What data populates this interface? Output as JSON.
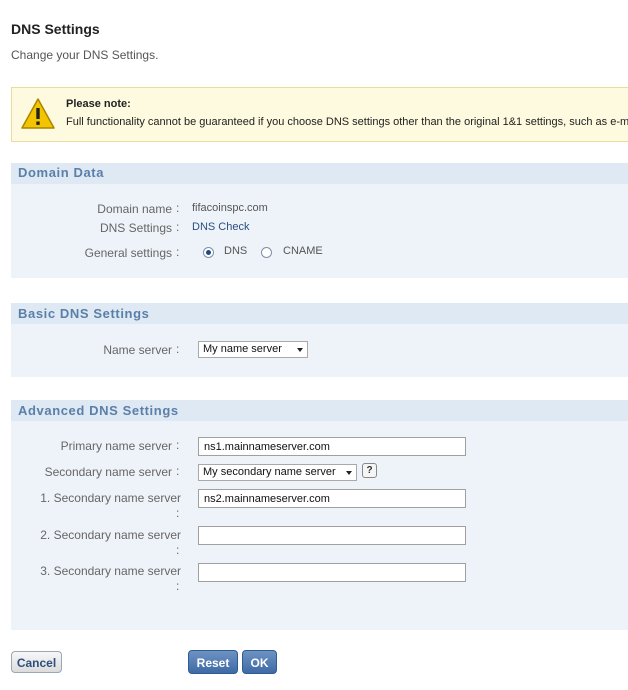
{
  "page": {
    "title": "DNS Settings",
    "subtitle": "Change your DNS Settings."
  },
  "note": {
    "icon": "warning-icon",
    "title": "Please note:",
    "text": "Full functionality cannot be guaranteed if you choose DNS settings other than the original 1&1 settings, such as e-ma"
  },
  "domain_data": {
    "heading": "Domain Data",
    "domain_name_label": "Domain name",
    "domain_name_value": "fifacoinspc.com",
    "dns_settings_label": "DNS Settings",
    "dns_settings_link": "DNS Check",
    "general_settings_label": "General settings",
    "radio_dns_label": "DNS",
    "radio_cname_label": "CNAME",
    "selected": "DNS"
  },
  "basic_dns": {
    "heading": "Basic DNS Settings",
    "name_server_label": "Name server",
    "name_server_value": "My name server"
  },
  "advanced_dns": {
    "heading": "Advanced DNS Settings",
    "primary_label": "Primary name server",
    "primary_value": "ns1.mainnameserver.com",
    "secondary_label": "Secondary name server",
    "secondary_select_value": "My secondary name server",
    "help_label": "?",
    "secondary1_label": "1. Secondary name server",
    "secondary1_value": "ns2.mainnameserver.com",
    "secondary2_label": "2. Secondary name server",
    "secondary2_value": "",
    "secondary3_label": "3. Secondary name server",
    "secondary3_value": ""
  },
  "common": {
    "colon": ":"
  },
  "buttons": {
    "cancel": "Cancel",
    "reset": "Reset",
    "ok": "OK"
  }
}
